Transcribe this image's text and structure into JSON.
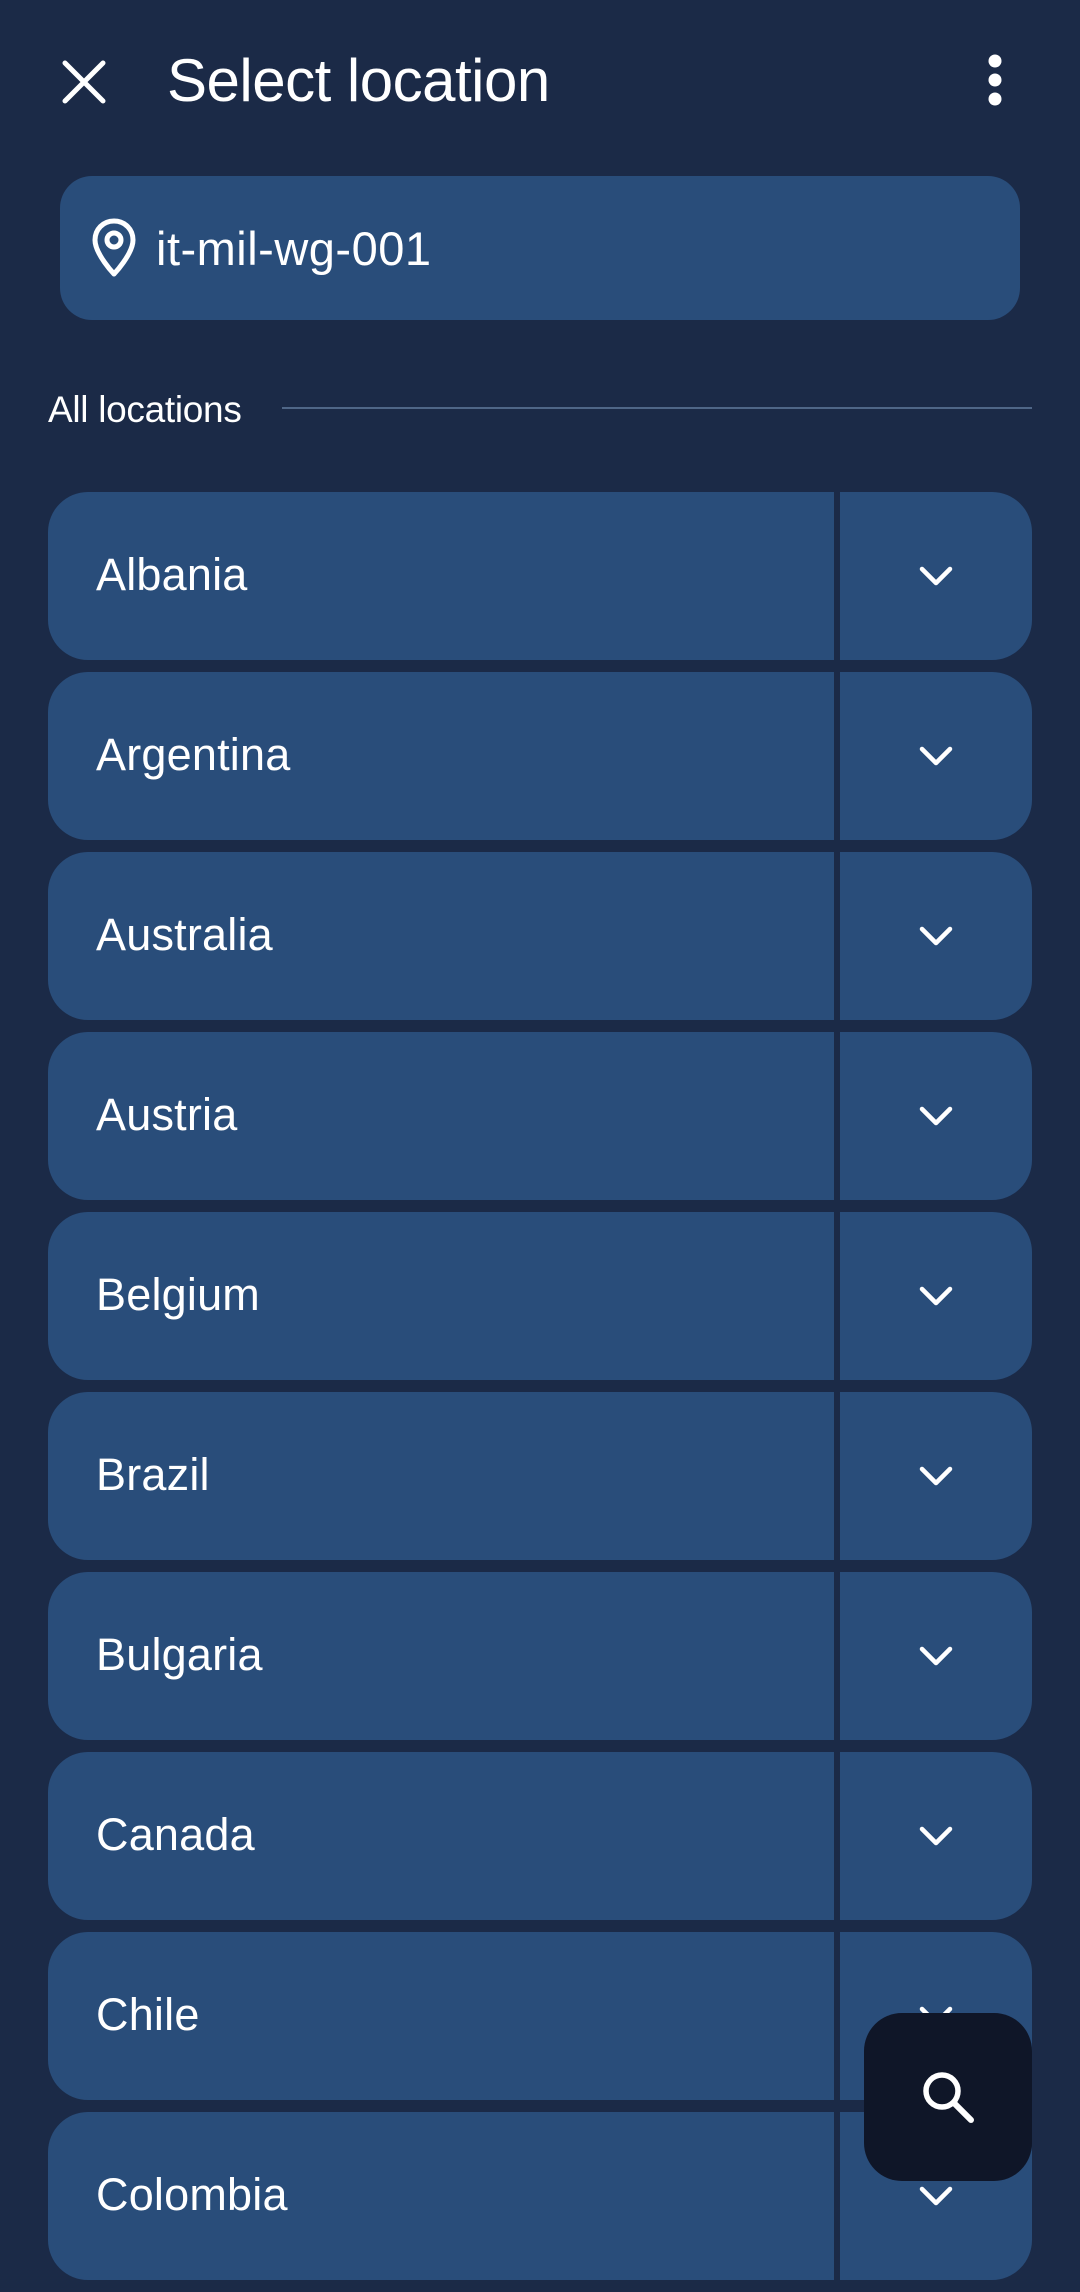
{
  "header": {
    "title": "Select location",
    "close_icon": "close-icon",
    "menu_icon": "more-vertical-icon"
  },
  "current_location": {
    "icon": "location-pin-icon",
    "value": "it-mil-wg-001"
  },
  "section": {
    "label": "All locations"
  },
  "locations": [
    {
      "name": "Albania"
    },
    {
      "name": "Argentina"
    },
    {
      "name": "Australia"
    },
    {
      "name": "Austria"
    },
    {
      "name": "Belgium"
    },
    {
      "name": "Brazil"
    },
    {
      "name": "Bulgaria"
    },
    {
      "name": "Canada"
    },
    {
      "name": "Chile"
    },
    {
      "name": "Colombia"
    }
  ],
  "fab": {
    "icon": "search-icon"
  },
  "colors": {
    "background": "#1b2a47",
    "item": "#294d7a",
    "fab": "#0f1628",
    "text": "#ffffff"
  }
}
